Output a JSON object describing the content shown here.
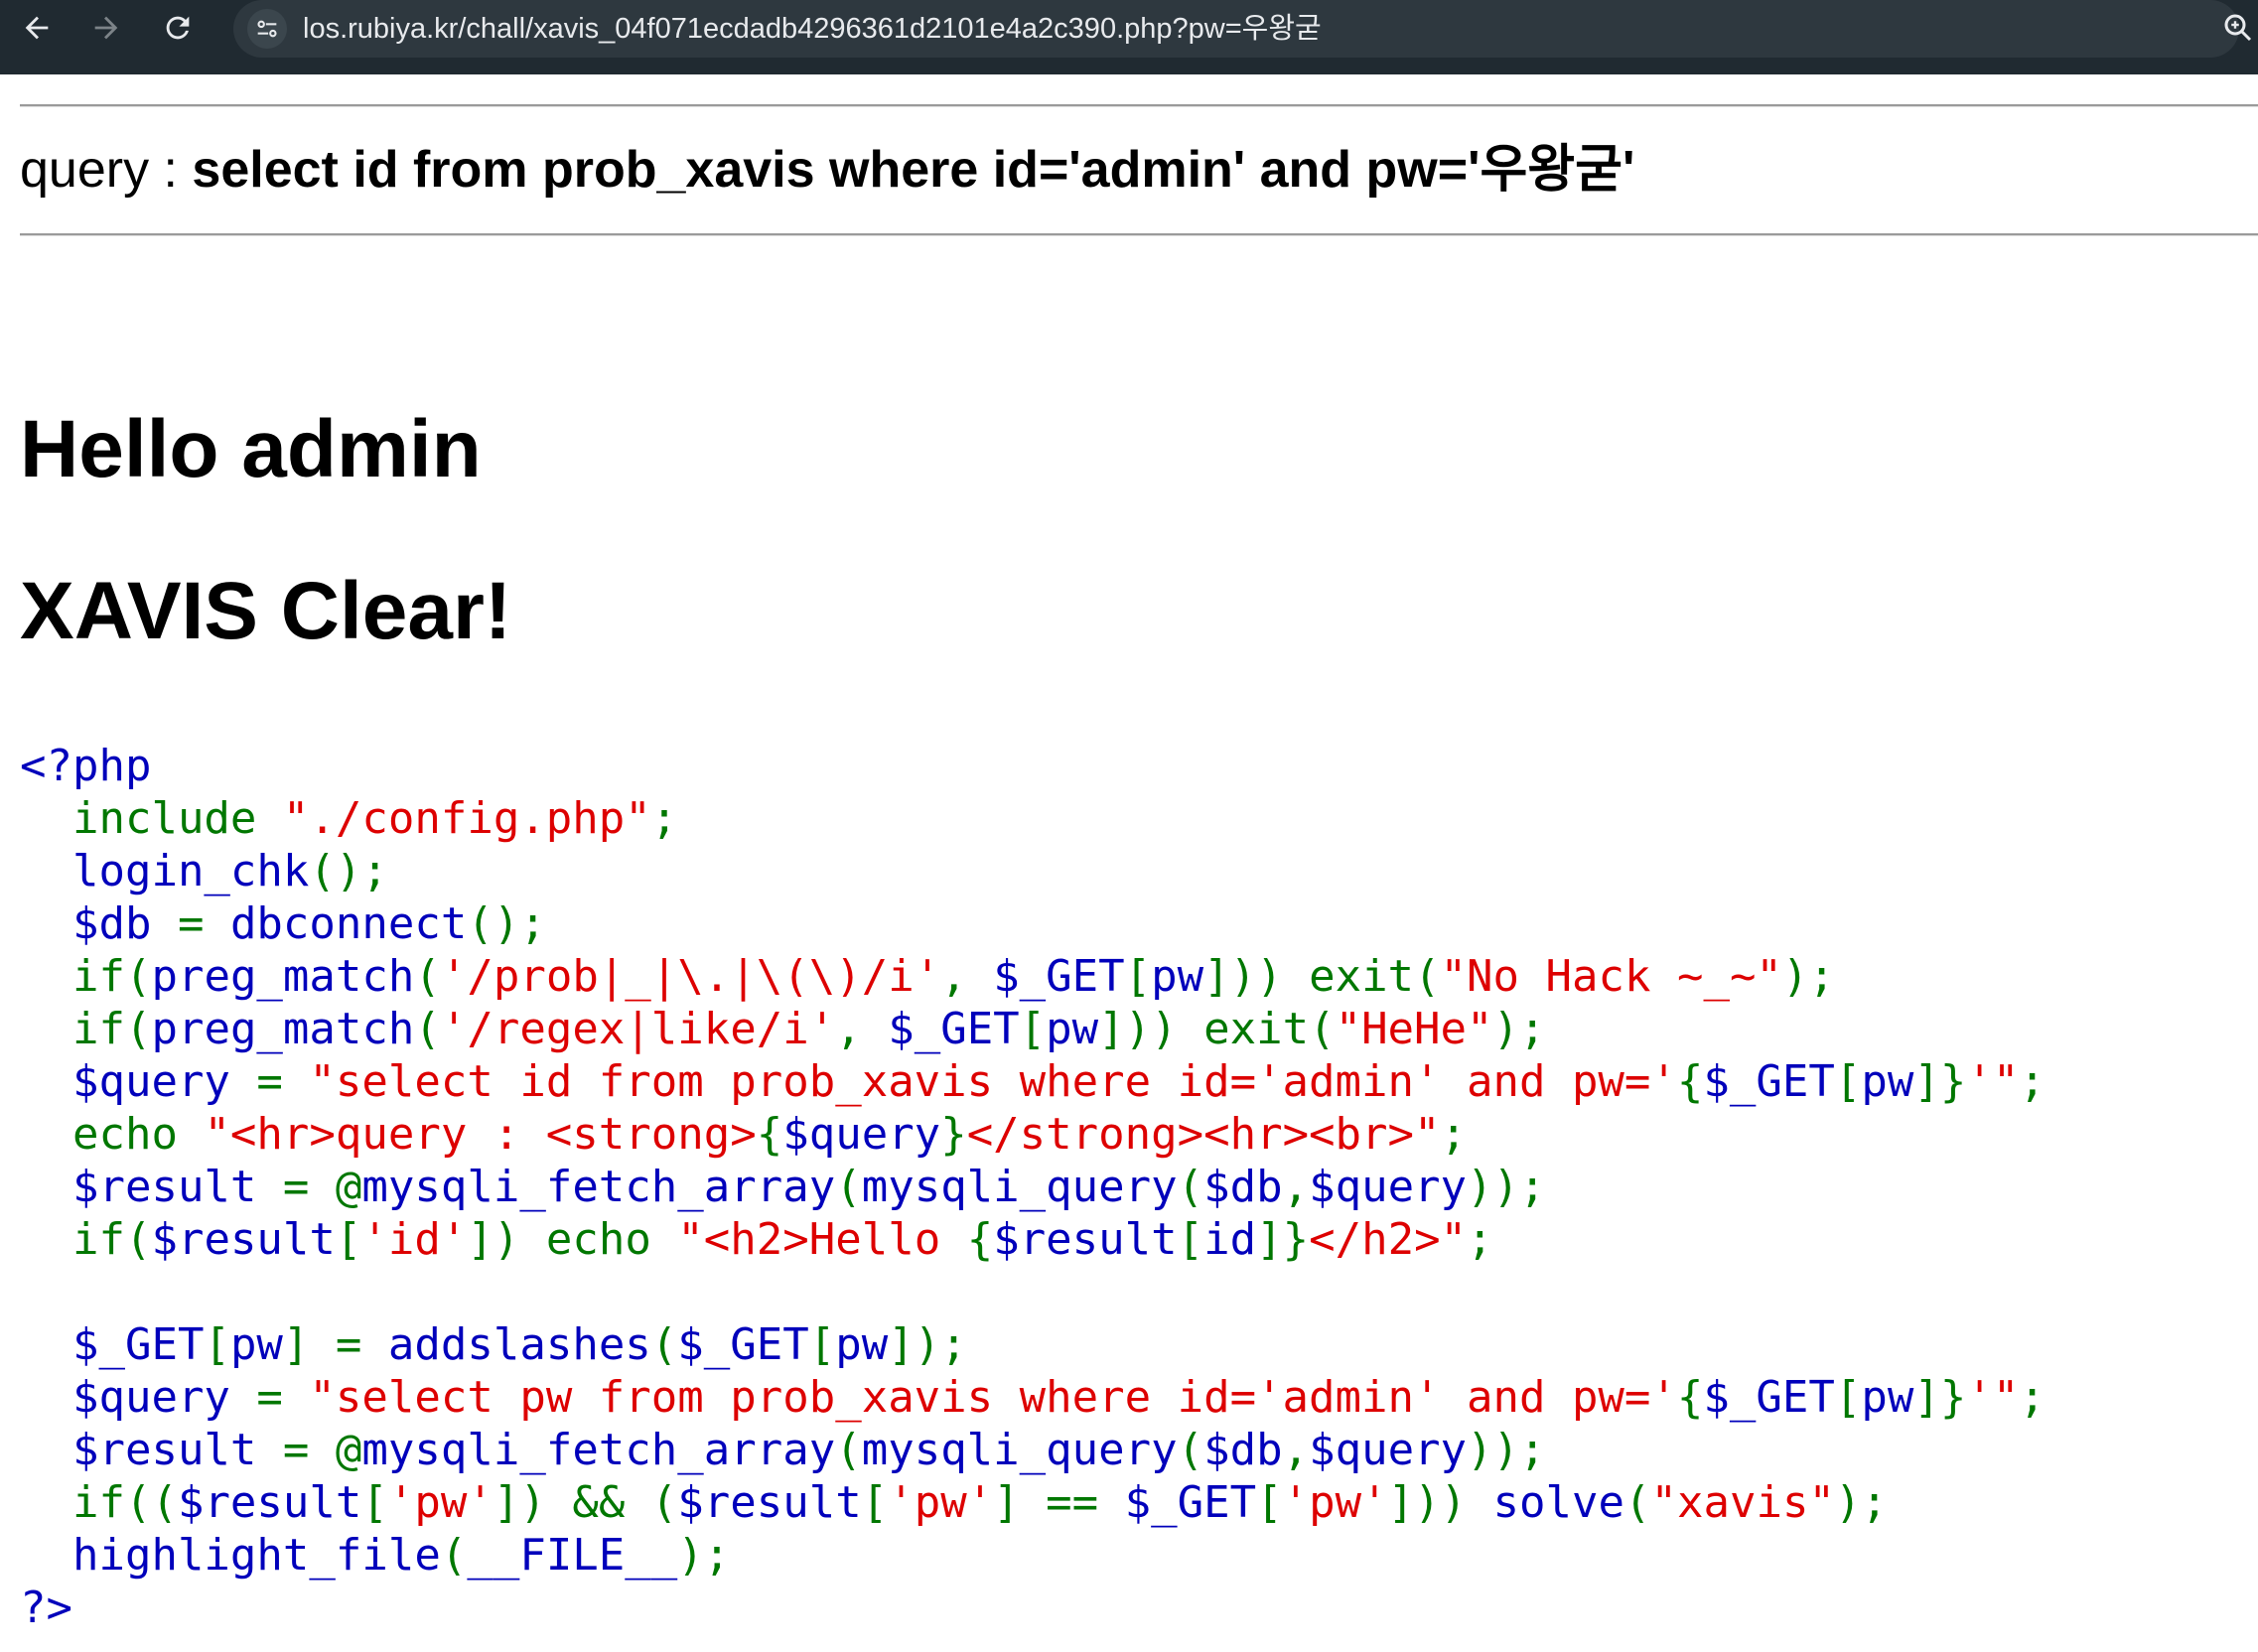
{
  "browser": {
    "url": "los.rubiya.kr/chall/xavis_04f071ecdadb4296361d2101e4a2c390.php?pw=우왕굳"
  },
  "page": {
    "query_label": "query : ",
    "query_sql": "select id from prob_xavis where id='admin' and pw='우왕굳'",
    "hello_text": "Hello admin",
    "clear_text": "XAVIS Clear!"
  },
  "code_colors": {
    "default": "#0000BB",
    "keyword": "#007700",
    "string": "#DD0000"
  },
  "source_code": [
    [
      [
        "default",
        "<?php"
      ]
    ],
    [
      [
        "default",
        "  "
      ],
      [
        "keyword",
        "include "
      ],
      [
        "string",
        "\"./config.php\""
      ],
      [
        "keyword",
        ";"
      ]
    ],
    [
      [
        "default",
        "  login_chk"
      ],
      [
        "keyword",
        "();"
      ]
    ],
    [
      [
        "default",
        "  $db "
      ],
      [
        "keyword",
        "= "
      ],
      [
        "default",
        "dbconnect"
      ],
      [
        "keyword",
        "();"
      ]
    ],
    [
      [
        "default",
        "  "
      ],
      [
        "keyword",
        "if("
      ],
      [
        "default",
        "preg_match"
      ],
      [
        "keyword",
        "("
      ],
      [
        "string",
        "'/prob|_|\\.|\\(\\)/i'"
      ],
      [
        "keyword",
        ", "
      ],
      [
        "default",
        "$_GET"
      ],
      [
        "keyword",
        "["
      ],
      [
        "default",
        "pw"
      ],
      [
        "keyword",
        "])) exit("
      ],
      [
        "string",
        "\"No Hack ~_~\""
      ],
      [
        "keyword",
        ");"
      ]
    ],
    [
      [
        "default",
        "  "
      ],
      [
        "keyword",
        "if("
      ],
      [
        "default",
        "preg_match"
      ],
      [
        "keyword",
        "("
      ],
      [
        "string",
        "'/regex|like/i'"
      ],
      [
        "keyword",
        ", "
      ],
      [
        "default",
        "$_GET"
      ],
      [
        "keyword",
        "["
      ],
      [
        "default",
        "pw"
      ],
      [
        "keyword",
        "])) exit("
      ],
      [
        "string",
        "\"HeHe\""
      ],
      [
        "keyword",
        ");"
      ]
    ],
    [
      [
        "default",
        "  $query "
      ],
      [
        "keyword",
        "= "
      ],
      [
        "string",
        "\"select id from prob_xavis where id='admin' and pw='"
      ],
      [
        "keyword",
        "{"
      ],
      [
        "default",
        "$_GET"
      ],
      [
        "keyword",
        "["
      ],
      [
        "default",
        "pw"
      ],
      [
        "keyword",
        "]}"
      ],
      [
        "string",
        "'\""
      ],
      [
        "keyword",
        ";"
      ]
    ],
    [
      [
        "default",
        "  "
      ],
      [
        "keyword",
        "echo "
      ],
      [
        "string",
        "\"<hr>query : <strong>"
      ],
      [
        "keyword",
        "{"
      ],
      [
        "default",
        "$query"
      ],
      [
        "keyword",
        "}"
      ],
      [
        "string",
        "</strong><hr><br>\""
      ],
      [
        "keyword",
        ";"
      ]
    ],
    [
      [
        "default",
        "  $result "
      ],
      [
        "keyword",
        "= @"
      ],
      [
        "default",
        "mysqli_fetch_array"
      ],
      [
        "keyword",
        "("
      ],
      [
        "default",
        "mysqli_query"
      ],
      [
        "keyword",
        "("
      ],
      [
        "default",
        "$db"
      ],
      [
        "keyword",
        ","
      ],
      [
        "default",
        "$query"
      ],
      [
        "keyword",
        "));"
      ]
    ],
    [
      [
        "default",
        "  "
      ],
      [
        "keyword",
        "if("
      ],
      [
        "default",
        "$result"
      ],
      [
        "keyword",
        "["
      ],
      [
        "string",
        "'id'"
      ],
      [
        "keyword",
        "]) echo "
      ],
      [
        "string",
        "\"<h2>Hello "
      ],
      [
        "keyword",
        "{"
      ],
      [
        "default",
        "$result"
      ],
      [
        "keyword",
        "["
      ],
      [
        "default",
        "id"
      ],
      [
        "keyword",
        "]}"
      ],
      [
        "string",
        "</h2>\""
      ],
      [
        "keyword",
        ";"
      ]
    ],
    [
      [
        "default",
        " "
      ]
    ],
    [
      [
        "default",
        "  $_GET"
      ],
      [
        "keyword",
        "["
      ],
      [
        "default",
        "pw"
      ],
      [
        "keyword",
        "] = "
      ],
      [
        "default",
        "addslashes"
      ],
      [
        "keyword",
        "("
      ],
      [
        "default",
        "$_GET"
      ],
      [
        "keyword",
        "["
      ],
      [
        "default",
        "pw"
      ],
      [
        "keyword",
        "]);"
      ]
    ],
    [
      [
        "default",
        "  $query "
      ],
      [
        "keyword",
        "= "
      ],
      [
        "string",
        "\"select pw from prob_xavis where id='admin' and pw='"
      ],
      [
        "keyword",
        "{"
      ],
      [
        "default",
        "$_GET"
      ],
      [
        "keyword",
        "["
      ],
      [
        "default",
        "pw"
      ],
      [
        "keyword",
        "]}"
      ],
      [
        "string",
        "'\""
      ],
      [
        "keyword",
        ";"
      ]
    ],
    [
      [
        "default",
        "  $result "
      ],
      [
        "keyword",
        "= @"
      ],
      [
        "default",
        "mysqli_fetch_array"
      ],
      [
        "keyword",
        "("
      ],
      [
        "default",
        "mysqli_query"
      ],
      [
        "keyword",
        "("
      ],
      [
        "default",
        "$db"
      ],
      [
        "keyword",
        ","
      ],
      [
        "default",
        "$query"
      ],
      [
        "keyword",
        "));"
      ]
    ],
    [
      [
        "default",
        "  "
      ],
      [
        "keyword",
        "if(("
      ],
      [
        "default",
        "$result"
      ],
      [
        "keyword",
        "["
      ],
      [
        "string",
        "'pw'"
      ],
      [
        "keyword",
        "]) && ("
      ],
      [
        "default",
        "$result"
      ],
      [
        "keyword",
        "["
      ],
      [
        "string",
        "'pw'"
      ],
      [
        "keyword",
        "] == "
      ],
      [
        "default",
        "$_GET"
      ],
      [
        "keyword",
        "["
      ],
      [
        "string",
        "'pw'"
      ],
      [
        "keyword",
        "])) "
      ],
      [
        "default",
        "solve"
      ],
      [
        "keyword",
        "("
      ],
      [
        "string",
        "\"xavis\""
      ],
      [
        "keyword",
        ");"
      ]
    ],
    [
      [
        "default",
        "  highlight_file"
      ],
      [
        "keyword",
        "("
      ],
      [
        "default",
        "__FILE__"
      ],
      [
        "keyword",
        ");"
      ]
    ],
    [
      [
        "default",
        "?>"
      ]
    ]
  ]
}
